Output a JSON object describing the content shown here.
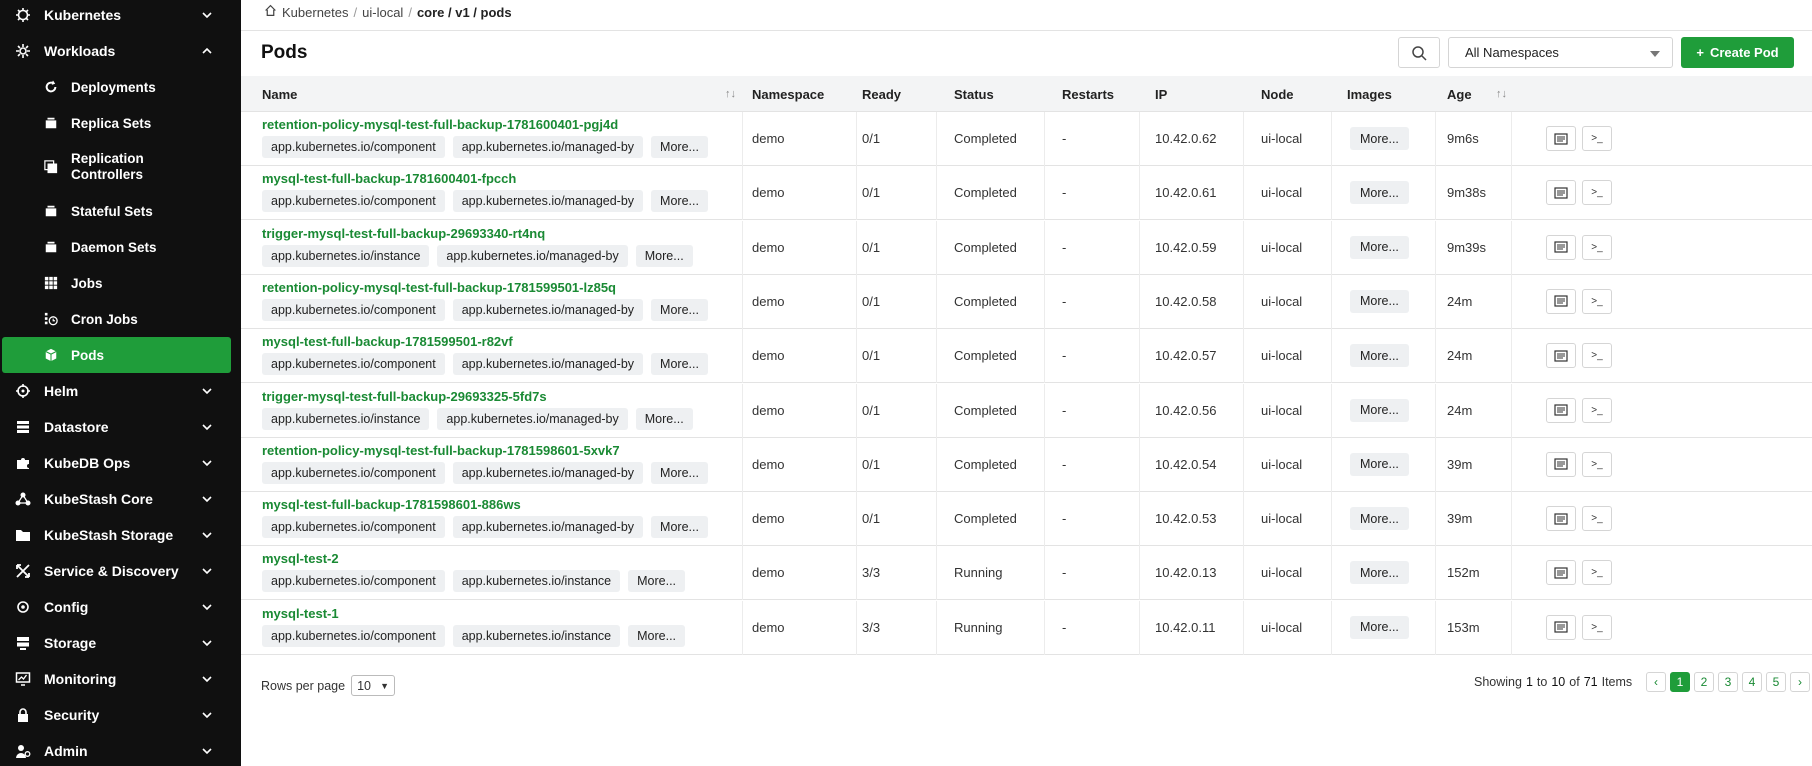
{
  "sidebar": {
    "top_items": [
      {
        "label": "Kubernetes",
        "icon": "helm-wheel-icon"
      },
      {
        "label": "Workloads",
        "icon": "gear-icon"
      },
      {
        "label": "Helm",
        "icon": "helm-icon"
      },
      {
        "label": "Datastore",
        "icon": "database-icon"
      },
      {
        "label": "KubeDB Ops",
        "icon": "puzzle-icon"
      },
      {
        "label": "KubeStash Core",
        "icon": "network-icon"
      },
      {
        "label": "KubeStash Storage",
        "icon": "folder-icon"
      },
      {
        "label": "Service & Discovery",
        "icon": "cross-arrows-icon"
      },
      {
        "label": "Config",
        "icon": "settings-icon"
      },
      {
        "label": "Storage",
        "icon": "server-icon"
      },
      {
        "label": "Monitoring",
        "icon": "monitor-chart-icon"
      },
      {
        "label": "Security",
        "icon": "lock-icon"
      },
      {
        "label": "Admin",
        "icon": "admin-user-icon"
      }
    ],
    "workload_items": [
      {
        "label": "Deployments",
        "icon": "refresh-icon"
      },
      {
        "label": "Replica Sets",
        "icon": "box-icon"
      },
      {
        "label": "Replication Controllers",
        "icon": "stack-icon"
      },
      {
        "label": "Stateful Sets",
        "icon": "box-icon"
      },
      {
        "label": "Daemon Sets",
        "icon": "box-icon"
      },
      {
        "label": "Jobs",
        "icon": "grid-icon"
      },
      {
        "label": "Cron Jobs",
        "icon": "cron-icon"
      },
      {
        "label": "Pods",
        "icon": "cube-icon"
      }
    ],
    "accent_color": "#1f9d3a"
  },
  "breadcrumb": {
    "home": "Kubernetes",
    "cluster": "ui-local",
    "current": "core / v1 / pods"
  },
  "header": {
    "title": "Pods",
    "namespace": "All Namespaces",
    "create_label": "Create Pod"
  },
  "table": {
    "columns": [
      "Name",
      "Namespace",
      "Ready",
      "Status",
      "Restarts",
      "IP",
      "Node",
      "Images",
      "Age"
    ],
    "more_label": "More...",
    "rows": [
      {
        "name": "retention-policy-mysql-test-full-backup-1781600401-pgj4d",
        "labels": [
          "app.kubernetes.io/component",
          "app.kubernetes.io/managed-by"
        ],
        "namespace": "demo",
        "ready": "0/1",
        "status": "Completed",
        "restarts": "-",
        "ip": "10.42.0.62",
        "node": "ui-local",
        "age": "9m6s"
      },
      {
        "name": "mysql-test-full-backup-1781600401-fpcch",
        "labels": [
          "app.kubernetes.io/component",
          "app.kubernetes.io/managed-by"
        ],
        "namespace": "demo",
        "ready": "0/1",
        "status": "Completed",
        "restarts": "-",
        "ip": "10.42.0.61",
        "node": "ui-local",
        "age": "9m38s"
      },
      {
        "name": "trigger-mysql-test-full-backup-29693340-rt4nq",
        "labels": [
          "app.kubernetes.io/instance",
          "app.kubernetes.io/managed-by"
        ],
        "namespace": "demo",
        "ready": "0/1",
        "status": "Completed",
        "restarts": "-",
        "ip": "10.42.0.59",
        "node": "ui-local",
        "age": "9m39s"
      },
      {
        "name": "retention-policy-mysql-test-full-backup-1781599501-lz85q",
        "labels": [
          "app.kubernetes.io/component",
          "app.kubernetes.io/managed-by"
        ],
        "namespace": "demo",
        "ready": "0/1",
        "status": "Completed",
        "restarts": "-",
        "ip": "10.42.0.58",
        "node": "ui-local",
        "age": "24m"
      },
      {
        "name": "mysql-test-full-backup-1781599501-r82vf",
        "labels": [
          "app.kubernetes.io/component",
          "app.kubernetes.io/managed-by"
        ],
        "namespace": "demo",
        "ready": "0/1",
        "status": "Completed",
        "restarts": "-",
        "ip": "10.42.0.57",
        "node": "ui-local",
        "age": "24m"
      },
      {
        "name": "trigger-mysql-test-full-backup-29693325-5fd7s",
        "labels": [
          "app.kubernetes.io/instance",
          "app.kubernetes.io/managed-by"
        ],
        "namespace": "demo",
        "ready": "0/1",
        "status": "Completed",
        "restarts": "-",
        "ip": "10.42.0.56",
        "node": "ui-local",
        "age": "24m"
      },
      {
        "name": "retention-policy-mysql-test-full-backup-1781598601-5xvk7",
        "labels": [
          "app.kubernetes.io/component",
          "app.kubernetes.io/managed-by"
        ],
        "namespace": "demo",
        "ready": "0/1",
        "status": "Completed",
        "restarts": "-",
        "ip": "10.42.0.54",
        "node": "ui-local",
        "age": "39m"
      },
      {
        "name": "mysql-test-full-backup-1781598601-886ws",
        "labels": [
          "app.kubernetes.io/component",
          "app.kubernetes.io/managed-by"
        ],
        "namespace": "demo",
        "ready": "0/1",
        "status": "Completed",
        "restarts": "-",
        "ip": "10.42.0.53",
        "node": "ui-local",
        "age": "39m"
      },
      {
        "name": "mysql-test-2",
        "labels": [
          "app.kubernetes.io/component",
          "app.kubernetes.io/instance"
        ],
        "namespace": "demo",
        "ready": "3/3",
        "status": "Running",
        "restarts": "-",
        "ip": "10.42.0.13",
        "node": "ui-local",
        "age": "152m"
      },
      {
        "name": "mysql-test-1",
        "labels": [
          "app.kubernetes.io/component",
          "app.kubernetes.io/instance"
        ],
        "namespace": "demo",
        "ready": "3/3",
        "status": "Running",
        "restarts": "-",
        "ip": "10.42.0.11",
        "node": "ui-local",
        "age": "153m"
      }
    ]
  },
  "footer": {
    "rows_per_page_label": "Rows per page",
    "rows_per_page": "10",
    "showing_label": "Showing",
    "from": "1",
    "to_label": "to",
    "to": "10",
    "of_label": "of",
    "total": "71",
    "items_label": "Items",
    "pages": [
      "1",
      "2",
      "3",
      "4",
      "5"
    ],
    "current_page": "1"
  }
}
